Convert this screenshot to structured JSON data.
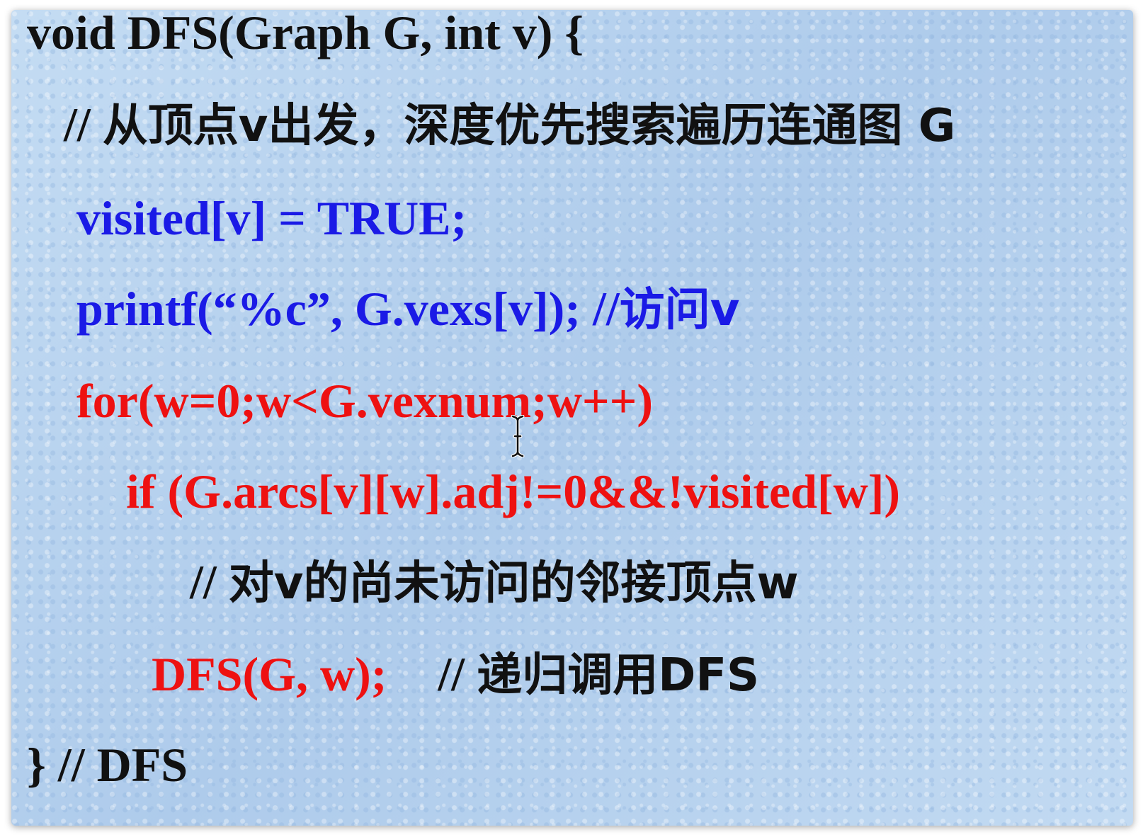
{
  "code_lines": [
    {
      "text": "void DFS(Graph G, int v) {"
    },
    {
      "prefix": "// ",
      "comment": "从顶点v出发，深度优先搜索遍历连通图 G"
    },
    {
      "text": "visited[v] = TRUE;"
    },
    {
      "code": "printf(“%c”, G.vexs[v]); //",
      "comment": "访问v"
    },
    {
      "text": "for(w=0;w<G.vexnum;w++)"
    },
    {
      "text": "if (G.arcs[v][w].adj!=0&&!visited[w])"
    },
    {
      "prefix": "// ",
      "comment": "对v的尚未访问的邻接顶点w"
    },
    {
      "code": "DFS(G, w);",
      "sep": "// ",
      "comment": "递归调用DFS"
    },
    {
      "text": "} // DFS"
    }
  ],
  "colors": {
    "background": "#b9d4ef",
    "default_text": "#111111",
    "blue_text": "#1a1ae6",
    "red_text": "#ee1111"
  },
  "icons": {
    "mouse_cursor": "text-ibeam-cursor-icon"
  }
}
